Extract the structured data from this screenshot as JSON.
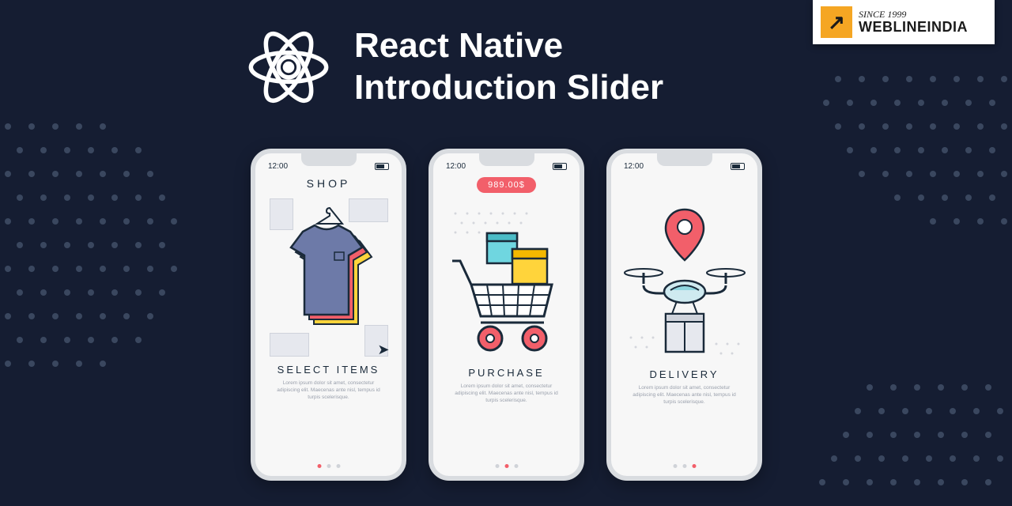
{
  "header": {
    "title_line1": "React Native",
    "title_line2": "Introduction Slider"
  },
  "logo": {
    "since": "SINCE 1999",
    "brand": "WEBLINEINDIA",
    "arrow_glyph": "↗"
  },
  "colors": {
    "bg": "#151d32",
    "accent": "#f25f6a",
    "badge_orange": "#f5a623"
  },
  "phones": [
    {
      "id": "shop",
      "time": "12:00",
      "top_label": "SHOP",
      "caption": "SELECT ITEMS",
      "lorem": "Lorem ipsum dolor sit amet, consectetur adipiscing elit. Maecenas ante nisl, tempus id turpis scelerisque.",
      "active_dot": 0
    },
    {
      "id": "purchase",
      "time": "12:00",
      "price": "989.00$",
      "caption": "PURCHASE",
      "lorem": "Lorem ipsum dolor sit amet, consectetur adipiscing elit. Maecenas ante nisl, tempus id turpis scelerisque.",
      "active_dot": 1
    },
    {
      "id": "delivery",
      "time": "12:00",
      "caption": "DELIVERY",
      "lorem": "Lorem ipsum dolor sit amet, consectetur adipiscing elit. Maecenas ante nisl, tempus id turpis scelerisque.",
      "active_dot": 2
    }
  ]
}
